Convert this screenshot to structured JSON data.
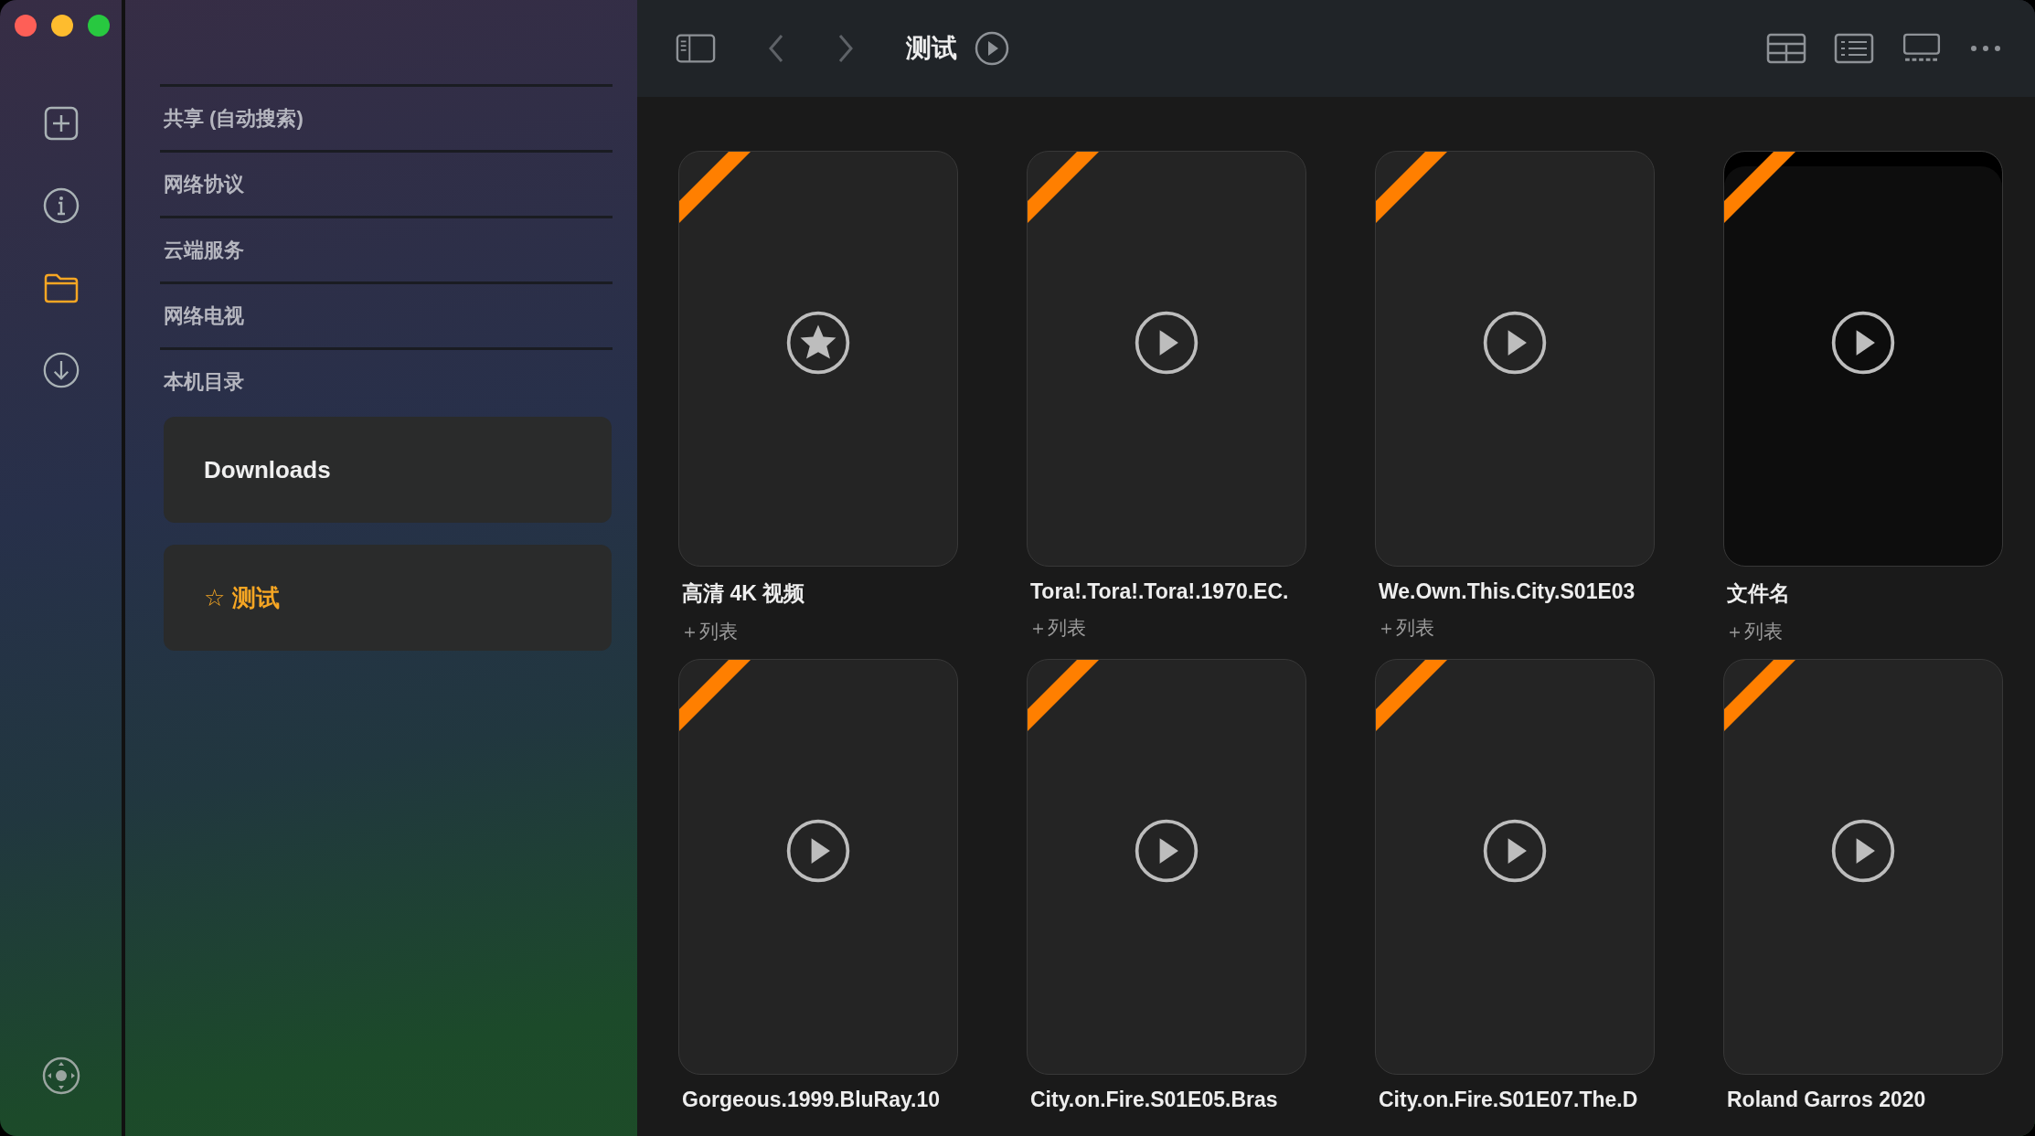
{
  "rail": [
    {
      "kind": "add",
      "selected": false
    },
    {
      "kind": "info",
      "selected": false
    },
    {
      "kind": "folder",
      "selected": true
    },
    {
      "kind": "download",
      "selected": false
    }
  ],
  "sidebar": {
    "sections": [
      "共享 (自动搜索)",
      "网络协议",
      "云端服务",
      "网络电视",
      "本机目录"
    ],
    "folders": [
      {
        "label": "Downloads",
        "selected": false
      },
      {
        "label": "测试",
        "star": "☆",
        "selected": true
      }
    ]
  },
  "toolbar": {
    "title": "测试"
  },
  "cards": [
    {
      "title": "高清 4K 视频",
      "subtitle": "＋列表",
      "kind": "star",
      "dark": false
    },
    {
      "title": "Tora!.Tora!.Tora!.1970.EC.",
      "subtitle": "＋列表",
      "kind": "play",
      "dark": false
    },
    {
      "title": "We.Own.This.City.S01E03",
      "subtitle": "＋列表",
      "kind": "play",
      "dark": false
    },
    {
      "title": "文件名",
      "subtitle": "＋列表",
      "kind": "play",
      "dark": true
    },
    {
      "title": "Gorgeous.1999.BluRay.10",
      "kind": "play",
      "dark": false
    },
    {
      "title": "City.on.Fire.S01E05.Bras",
      "kind": "play",
      "dark": false
    },
    {
      "title": "City.on.Fire.S01E07.The.D",
      "kind": "play",
      "dark": false
    },
    {
      "title": "Roland Garros 2020",
      "kind": "play",
      "dark": false
    }
  ]
}
